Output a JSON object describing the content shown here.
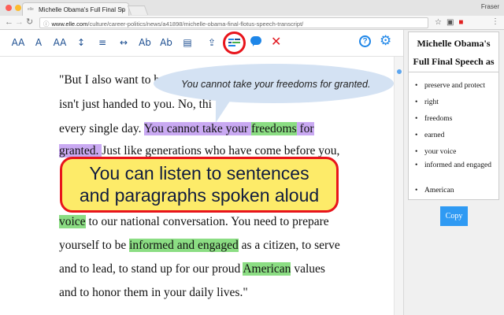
{
  "browser": {
    "tab_title": "Michelle Obama's Full Final Sp",
    "tab_favicon": "elle",
    "profile_name": "Fraser",
    "url_domain": "www.elle.com",
    "url_path": "/culture/career-politics/news/a41898/michelle-obama-final-flotus-speech-transcript/"
  },
  "toolbar": {
    "buttons": [
      {
        "name": "font-size-decrease-icon",
        "glyph": "AA"
      },
      {
        "name": "font-size-increase-icon",
        "glyph": "A"
      },
      {
        "name": "font-style-icon",
        "glyph": "AA"
      },
      {
        "name": "line-spacing-icon",
        "glyph": "↕"
      },
      {
        "name": "paragraph-spacing-icon",
        "glyph": "≡"
      },
      {
        "name": "letter-spacing-icon",
        "glyph": "↔"
      },
      {
        "name": "syllables-icon",
        "glyph": "Ab"
      },
      {
        "name": "parts-of-speech-icon",
        "glyph": "Ab"
      },
      {
        "name": "reading-guide-icon",
        "glyph": "▤"
      },
      {
        "name": "export-icon",
        "glyph": "⇪"
      }
    ],
    "accent_color": "#1e86e8",
    "highlight_ring_color": "#e8141b",
    "close_glyph": "✕",
    "help_glyph": "?",
    "settings_glyph": "⚙"
  },
  "article": {
    "lines": [
      [
        {
          "t": "\"But I also want to be yo"
        }
      ],
      [
        {
          "t": "isn't just handed to you. No, thi"
        }
      ],
      [
        {
          "t": "every single day. "
        },
        {
          "t": "You cannot take your ",
          "hl": "purple"
        },
        {
          "t": "freedoms",
          "hl": "green"
        },
        {
          "t": " for",
          "hl": "purple"
        }
      ],
      [
        {
          "t": "granted. ",
          "hl": "purple"
        },
        {
          "t": "Just like generations who have come before you,"
        }
      ],
      [
        {
          "t": "voice",
          "hl": "green"
        },
        {
          "t": " to our national conversation. You need to prepare"
        }
      ],
      [
        {
          "t": "yourself to be "
        },
        {
          "t": "informed and engaged",
          "hl": "green"
        },
        {
          "t": " as a citizen, to serve"
        }
      ],
      [
        {
          "t": "and to lead, to stand up for our proud "
        },
        {
          "t": "American",
          "hl": "green"
        },
        {
          "t": " values"
        }
      ],
      [
        {
          "t": "and to honor them in your daily lives.\""
        }
      ]
    ],
    "highlight_colors": {
      "purple": "#c9a9f2",
      "green": "#8bdd83"
    }
  },
  "tooltip": {
    "text": "You cannot take your freedoms for granted."
  },
  "callout": {
    "line1": "You can listen to sentences",
    "line2": "and paragraphs spoken aloud"
  },
  "side_panel": {
    "title_line1": "Michelle Obama's",
    "title_line2": "Full Final Speech as",
    "keywords": [
      "preserve and protect",
      "right",
      "freedoms",
      "earned",
      "your voice",
      "informed and engaged",
      "American"
    ],
    "copy_label": "Copy"
  }
}
